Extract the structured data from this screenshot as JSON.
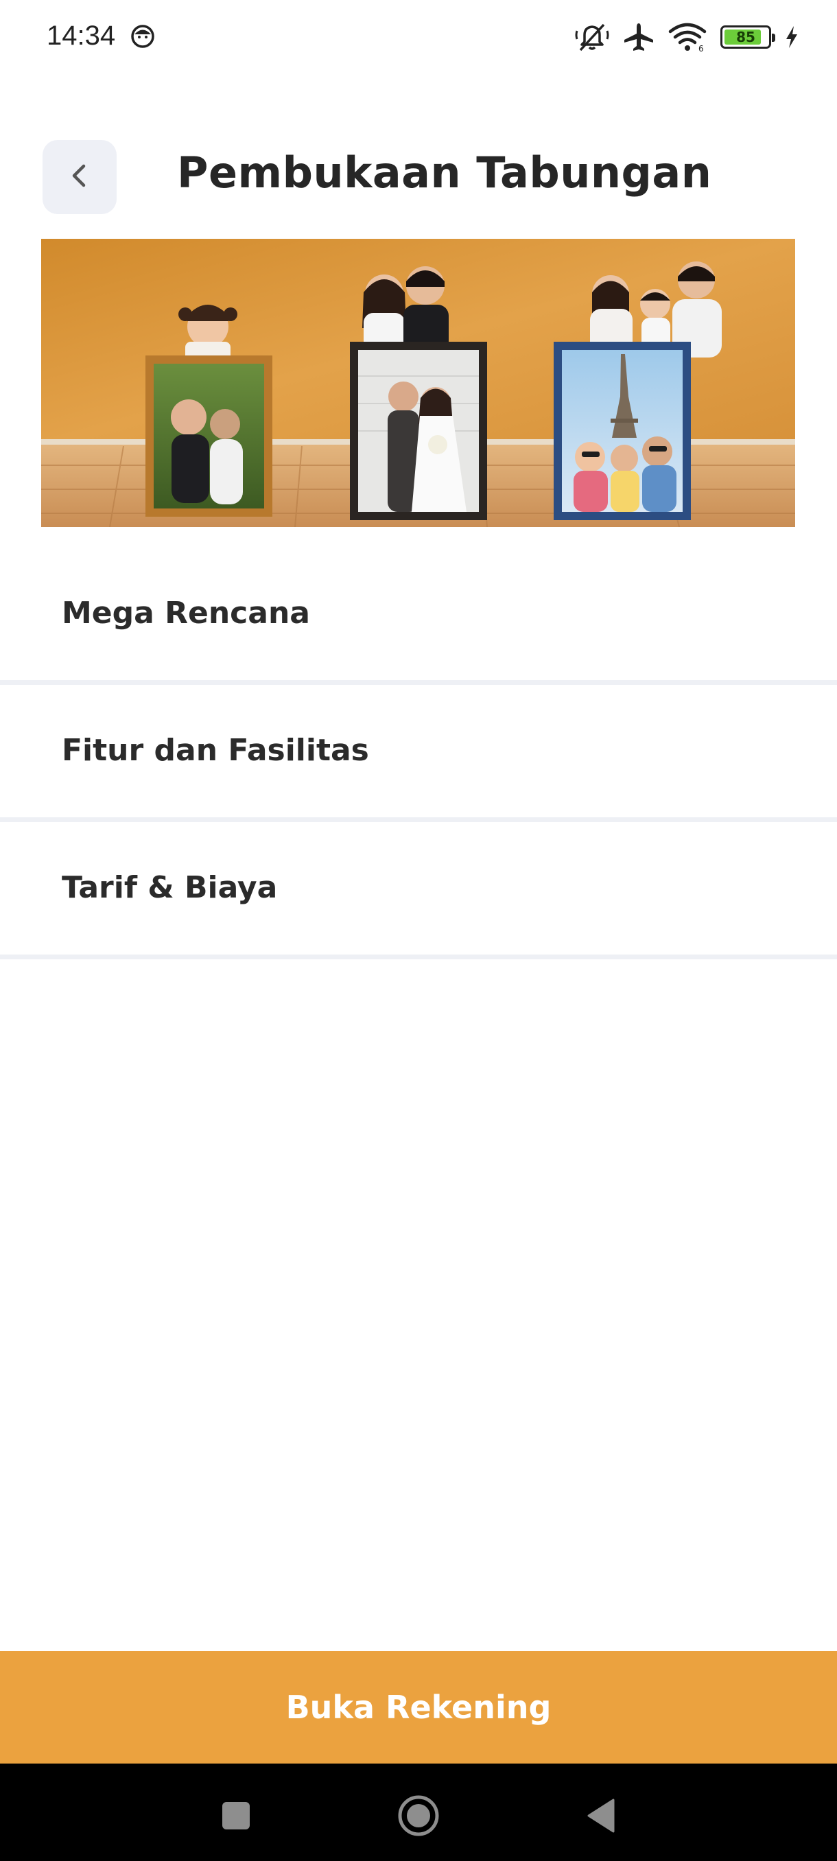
{
  "status_bar": {
    "time": "14:34",
    "battery_level": "85",
    "battery_fraction": 0.85,
    "icons": [
      "face-notification-icon",
      "mute-icon",
      "airplane-mode-icon",
      "wifi-icon",
      "battery-icon",
      "charging-icon"
    ]
  },
  "header": {
    "title": "Pembukaan Tabungan",
    "back_icon": "chevron-left-icon"
  },
  "banner": {
    "description_icon": "family-photo-frames-banner"
  },
  "menu": {
    "items": [
      {
        "label": "Mega Rencana"
      },
      {
        "label": "Fitur dan Fasilitas"
      },
      {
        "label": "Tarif & Biaya"
      }
    ]
  },
  "cta": {
    "label": "Buka Rekening"
  },
  "colors": {
    "accent": "#eba23f",
    "divider": "#eef0f5",
    "back_button_bg": "#eef0f6"
  },
  "nav_bar": {
    "icons": [
      "recent-apps-icon",
      "home-icon",
      "back-triangle-icon"
    ]
  }
}
